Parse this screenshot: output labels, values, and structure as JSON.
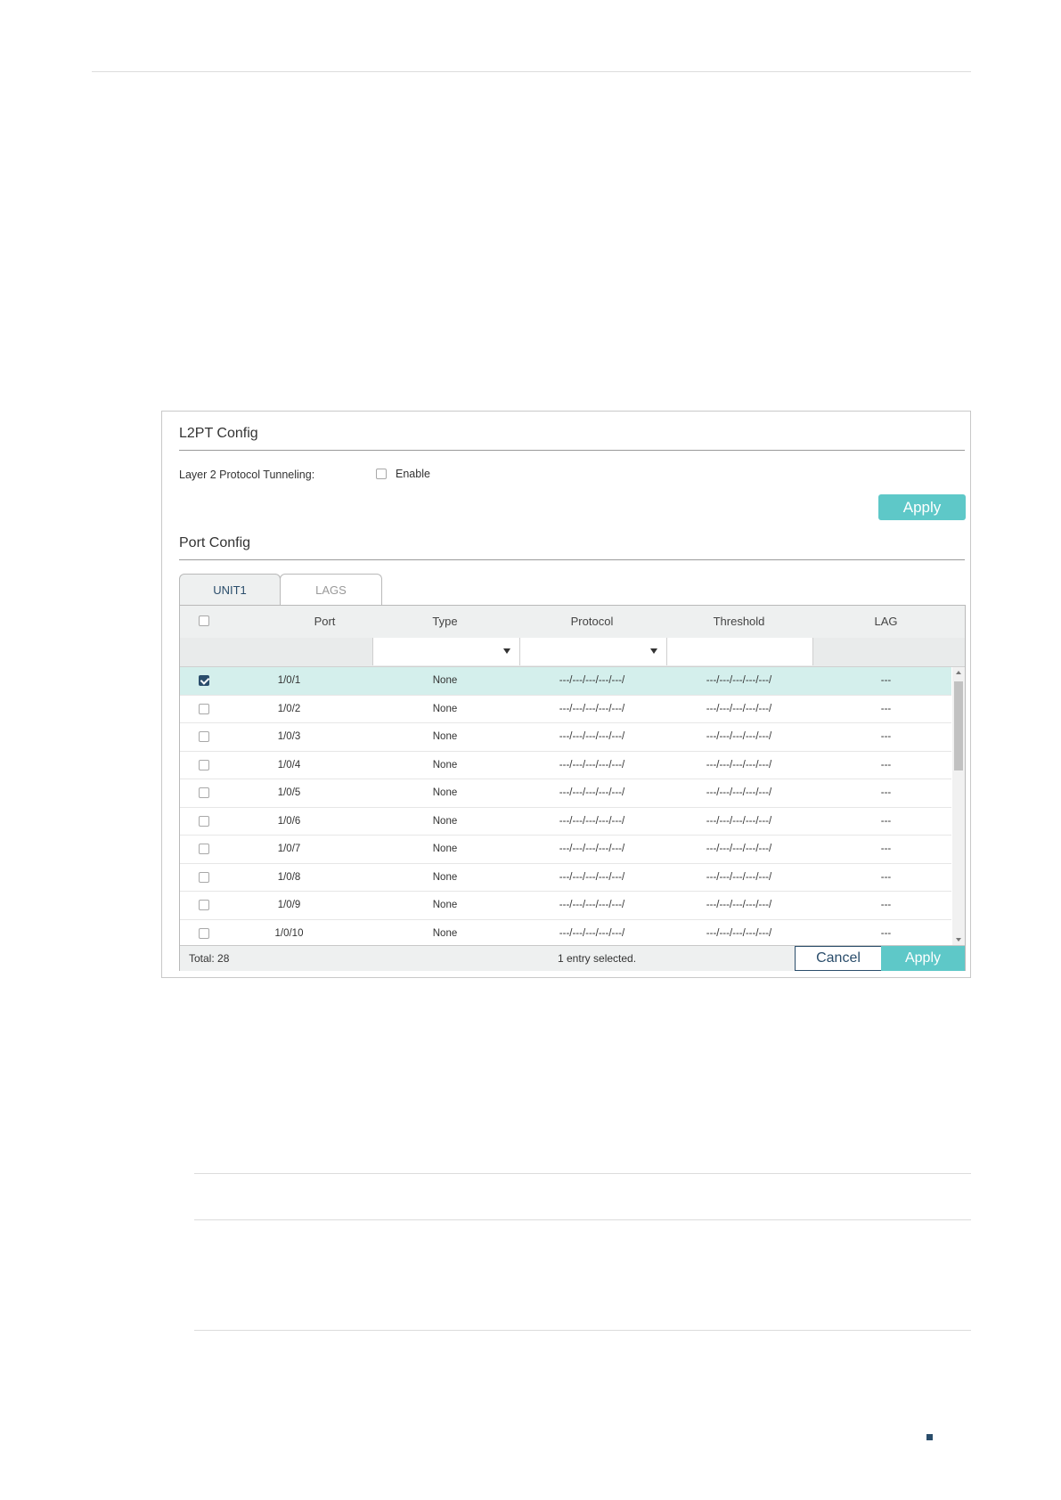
{
  "l2pt_config": {
    "title": "L2PT Config",
    "tunneling_label": "Layer 2 Protocol Tunneling:",
    "enable_label": "Enable",
    "enable_checked": false,
    "apply_label": "Apply"
  },
  "port_config": {
    "title": "Port Config",
    "tabs": [
      {
        "label": "UNIT1",
        "active": true
      },
      {
        "label": "LAGS",
        "active": false
      }
    ],
    "columns": [
      "Port",
      "Type",
      "Protocol",
      "Threshold",
      "LAG"
    ],
    "rows": [
      {
        "port": "1/0/1",
        "type": "None",
        "protocol": "---/---/---/---/---/",
        "threshold": "---/---/---/---/---/",
        "lag": "---",
        "checked": true
      },
      {
        "port": "1/0/2",
        "type": "None",
        "protocol": "---/---/---/---/---/",
        "threshold": "---/---/---/---/---/",
        "lag": "---",
        "checked": false
      },
      {
        "port": "1/0/3",
        "type": "None",
        "protocol": "---/---/---/---/---/",
        "threshold": "---/---/---/---/---/",
        "lag": "---",
        "checked": false
      },
      {
        "port": "1/0/4",
        "type": "None",
        "protocol": "---/---/---/---/---/",
        "threshold": "---/---/---/---/---/",
        "lag": "---",
        "checked": false
      },
      {
        "port": "1/0/5",
        "type": "None",
        "protocol": "---/---/---/---/---/",
        "threshold": "---/---/---/---/---/",
        "lag": "---",
        "checked": false
      },
      {
        "port": "1/0/6",
        "type": "None",
        "protocol": "---/---/---/---/---/",
        "threshold": "---/---/---/---/---/",
        "lag": "---",
        "checked": false
      },
      {
        "port": "1/0/7",
        "type": "None",
        "protocol": "---/---/---/---/---/",
        "threshold": "---/---/---/---/---/",
        "lag": "---",
        "checked": false
      },
      {
        "port": "1/0/8",
        "type": "None",
        "protocol": "---/---/---/---/---/",
        "threshold": "---/---/---/---/---/",
        "lag": "---",
        "checked": false
      },
      {
        "port": "1/0/9",
        "type": "None",
        "protocol": "---/---/---/---/---/",
        "threshold": "---/---/---/---/---/",
        "lag": "---",
        "checked": false
      },
      {
        "port": "1/0/10",
        "type": "None",
        "protocol": "---/---/---/---/---/",
        "threshold": "---/---/---/---/---/",
        "lag": "---",
        "checked": false
      }
    ],
    "footer": {
      "total": "Total: 28",
      "selected": "1 entry selected.",
      "cancel_label": "Cancel",
      "apply_label": "Apply"
    }
  },
  "colors": {
    "accent": "#5ec8c8",
    "selected_row": "#d4efec",
    "primary": "#2a4d6b"
  }
}
